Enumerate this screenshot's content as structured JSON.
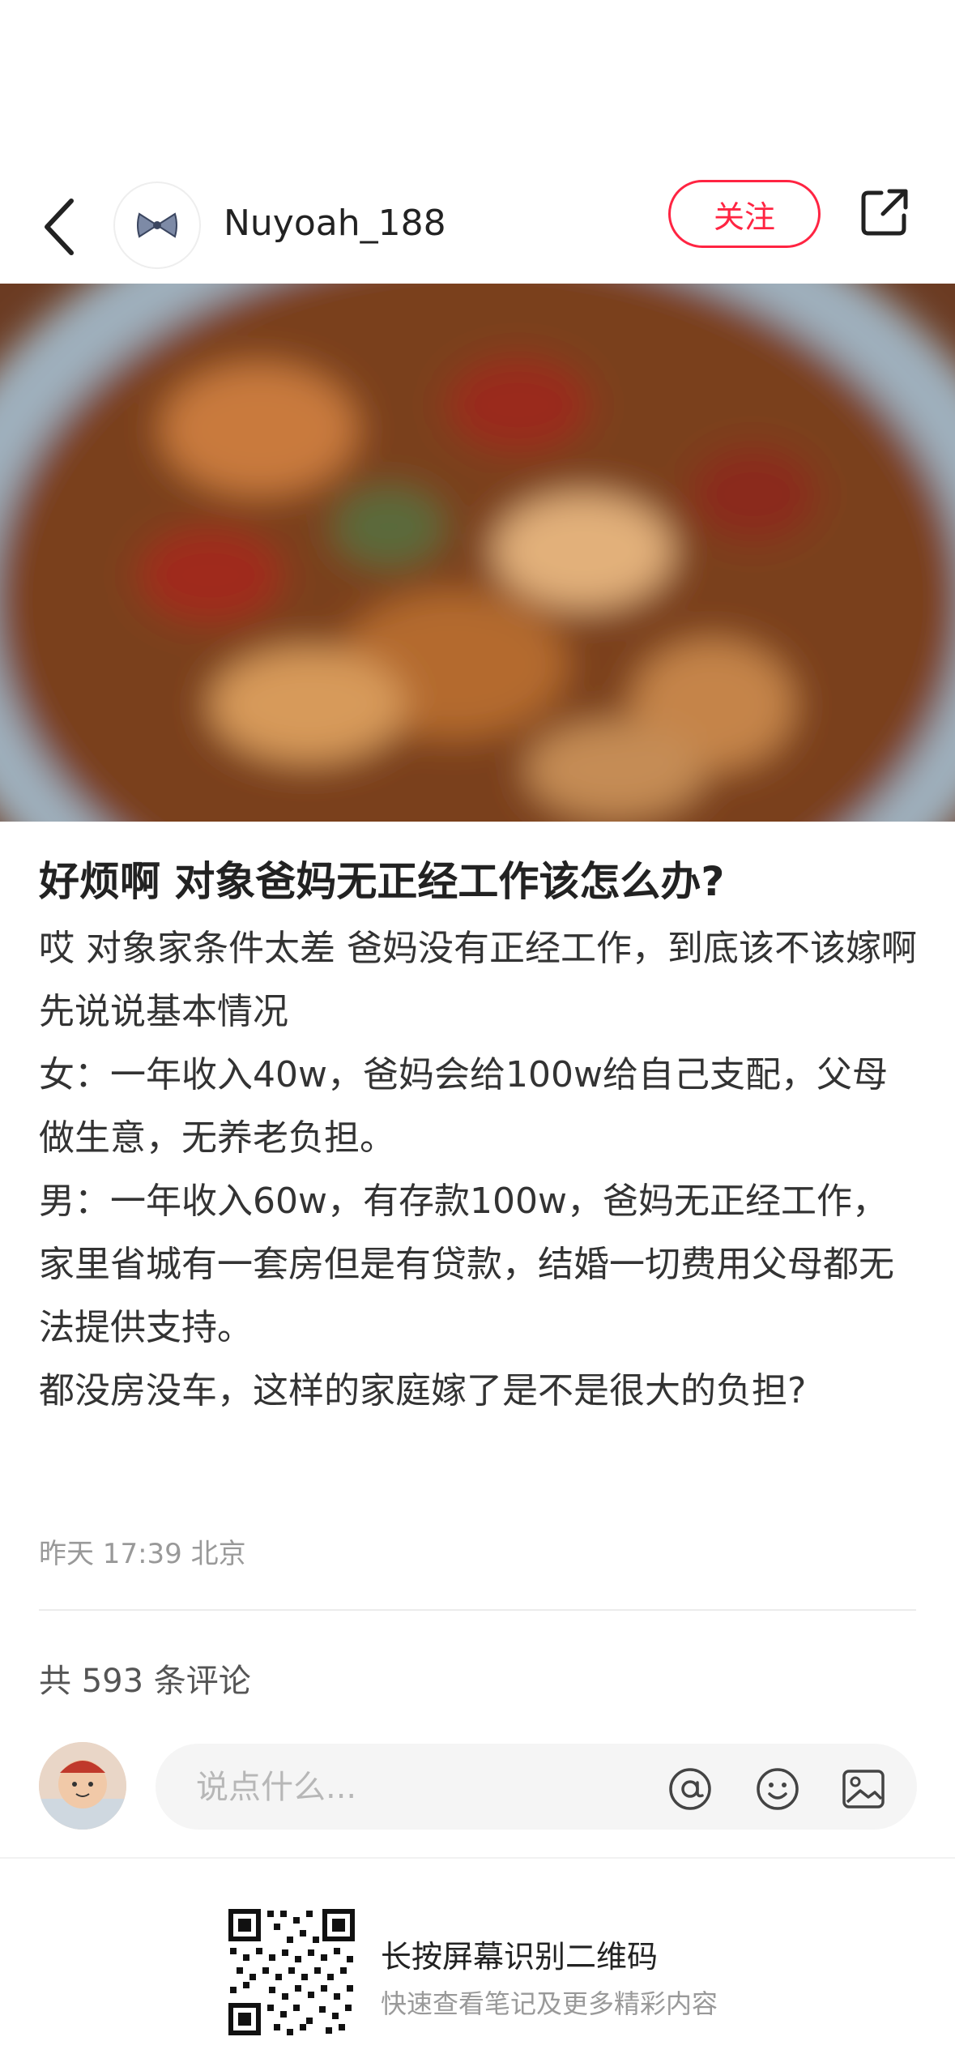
{
  "header": {
    "author_name": "Nuyoah_188",
    "follow_label": "关注"
  },
  "post": {
    "title": "好烦啊 对象爸妈无正经工作该怎么办?",
    "content_lines": [
      "哎 对象家条件太差 爸妈没有正经工作，到底该不该嫁啊",
      "先说说基本情况",
      "女：一年收入40w，爸妈会给100w给自己支配，父母做生意，无养老负担。",
      "男：一年收入60w，有存款100w，爸妈无正经工作，家里省城有一套房但是有贷款，结婚一切费用父母都无法提供支持。",
      "都没房没车，这样的家庭嫁了是不是很大的负担?"
    ],
    "meta": "昨天 17:39 北京"
  },
  "comments": {
    "count_text": "共 593 条评论",
    "input_placeholder": "说点什么..."
  },
  "footer": {
    "qr_main": "长按屏幕识别二维码",
    "qr_sub": "快速查看笔记及更多精彩内容"
  },
  "colors": {
    "accent": "#ff2442",
    "muted": "#999999"
  }
}
